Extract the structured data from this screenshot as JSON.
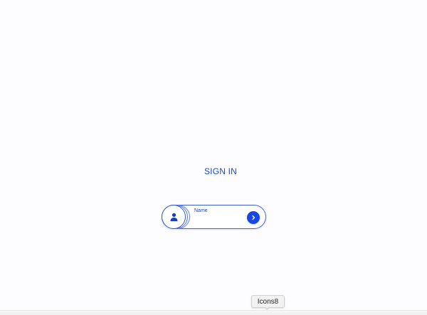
{
  "header": {
    "title": "SIGN IN"
  },
  "signin": {
    "field_label": "Name",
    "field_value": "",
    "field_placeholder": "",
    "next_button_label": "next"
  },
  "tooltip": {
    "text": "Icons8"
  },
  "icons": {
    "avatar": "user-icon",
    "next": "chevron-right-icon"
  },
  "colors": {
    "accent": "#1746e3",
    "accent_dark": "#1f47c8",
    "background": "#fdfdff"
  }
}
